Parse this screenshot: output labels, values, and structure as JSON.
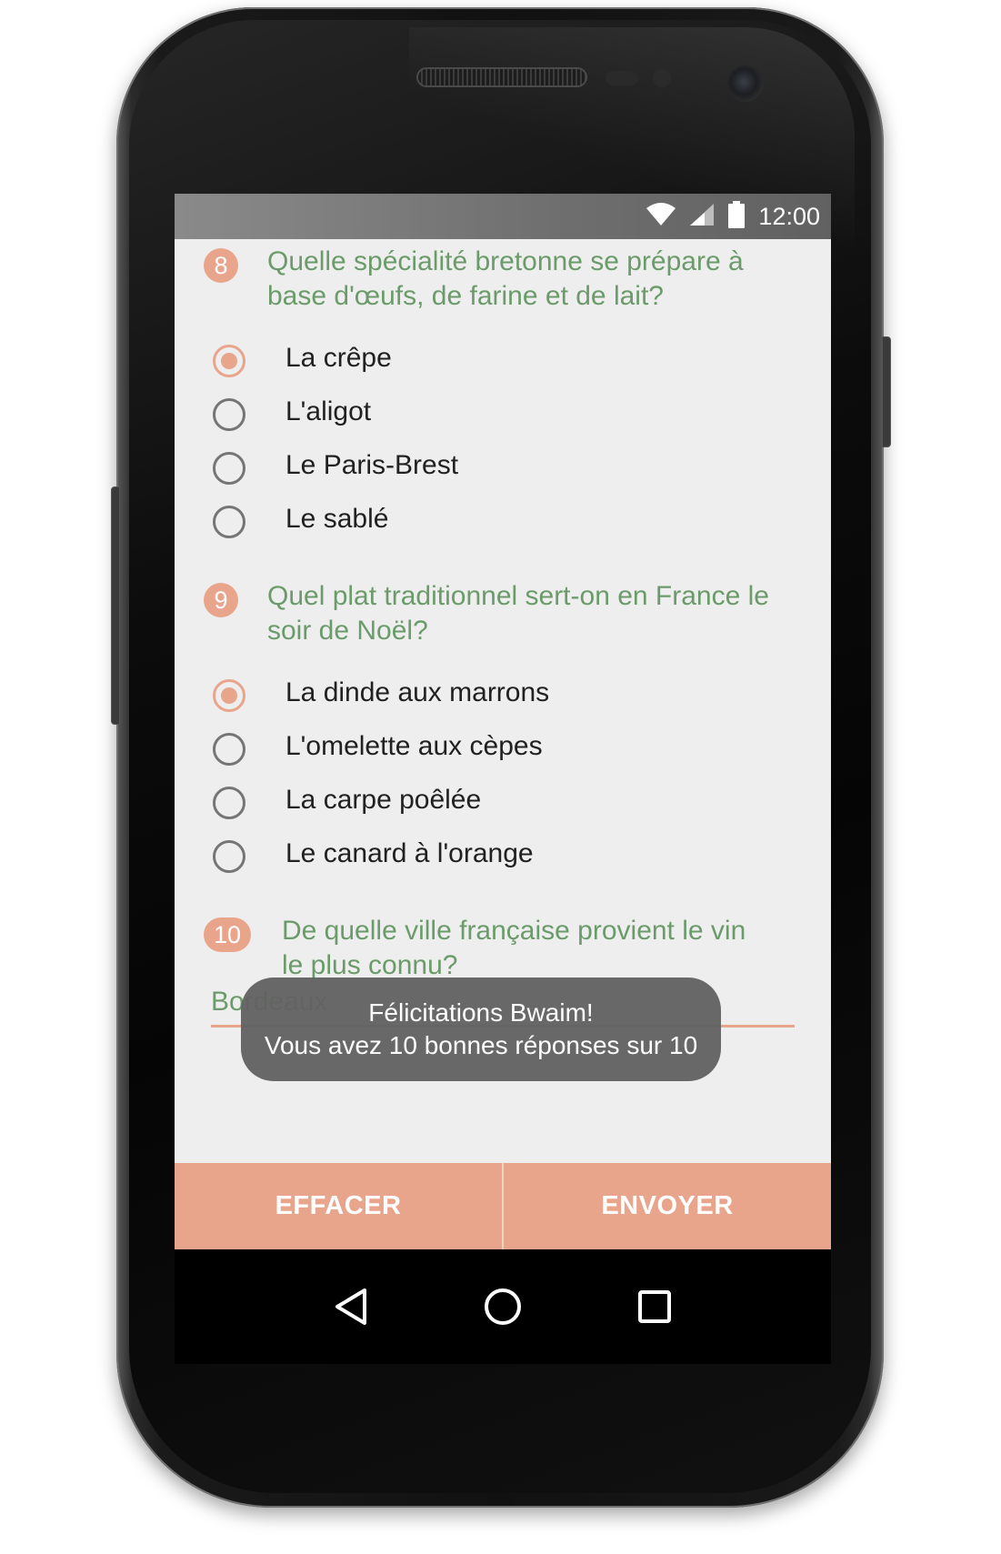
{
  "status_bar": {
    "time": "12:00",
    "icons": [
      "wifi-icon",
      "signal-icon",
      "battery-icon"
    ]
  },
  "questions": [
    {
      "number": "8",
      "text_line1": "Quelle spécialité bretonne se prépare à",
      "text_line2": "base d'œufs, de farine et de lait?",
      "options": [
        {
          "label": "La crêpe",
          "selected": true
        },
        {
          "label": "L'aligot",
          "selected": false
        },
        {
          "label": "Le Paris-Brest",
          "selected": false
        },
        {
          "label": "Le sablé",
          "selected": false
        }
      ]
    },
    {
      "number": "9",
      "text_line1": "Quel plat traditionnel sert-on en France le",
      "text_line2": "soir de Noël?",
      "options": [
        {
          "label": "La dinde aux marrons",
          "selected": true
        },
        {
          "label": "L'omelette aux cèpes",
          "selected": false
        },
        {
          "label": "La carpe poêlée",
          "selected": false
        },
        {
          "label": "Le canard à l'orange",
          "selected": false
        }
      ]
    },
    {
      "number": "10",
      "text_line1": "De quelle ville française provient le vin",
      "text_line2": "le plus connu?",
      "answer_value": "Bordeaux"
    }
  ],
  "toast": {
    "line1": "Félicitations Bwaim!",
    "line2": "Vous avez 10 bonnes réponses sur 10"
  },
  "actions": {
    "clear_label": "EFFACER",
    "submit_label": "ENVOYER"
  },
  "nav": {
    "icons": [
      "back-icon",
      "home-icon",
      "recents-icon"
    ]
  },
  "colors": {
    "accent": "#e8a58b",
    "question_text": "#6b9b6a",
    "screen_bg": "#eeeeee"
  }
}
